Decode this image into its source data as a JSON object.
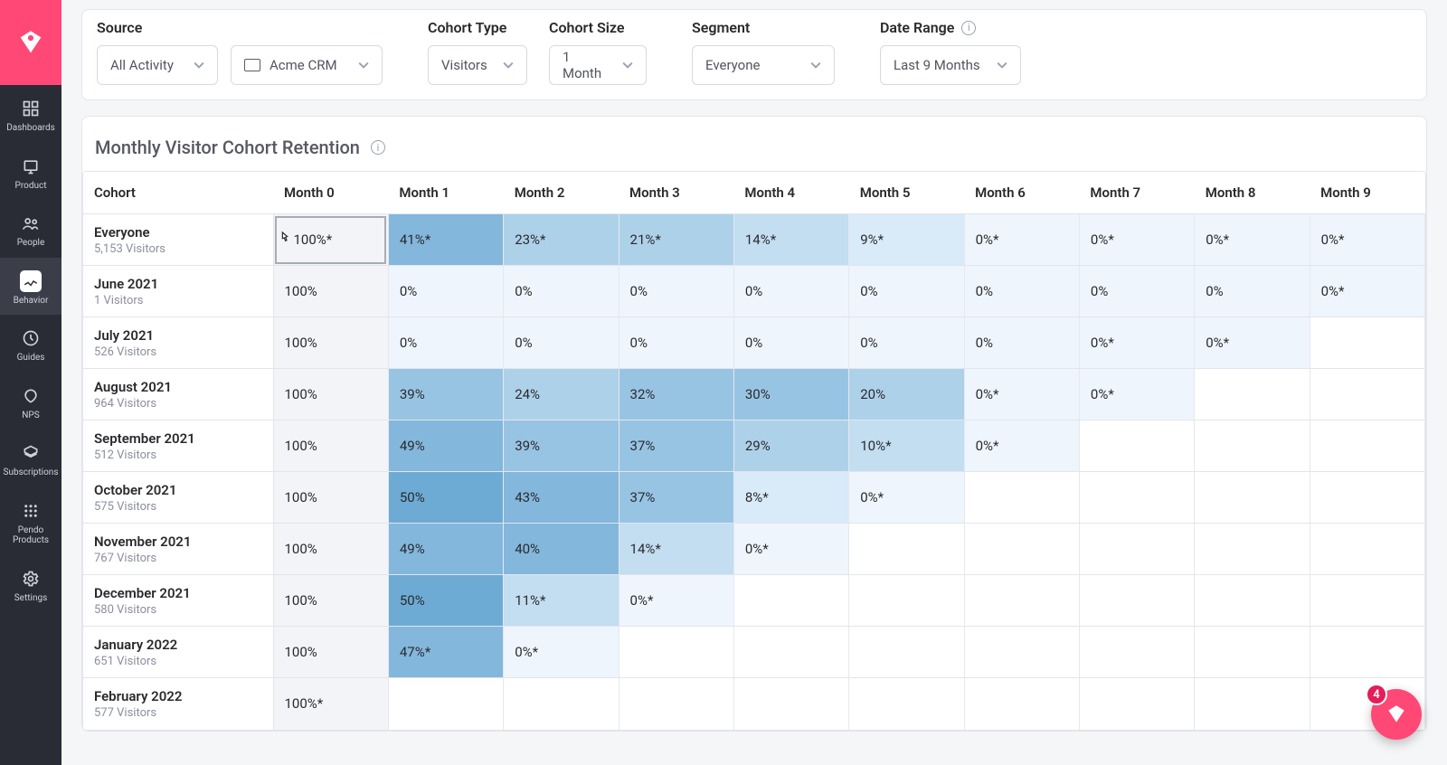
{
  "sidebar": {
    "items": [
      {
        "label": "Dashboards"
      },
      {
        "label": "Product"
      },
      {
        "label": "People"
      },
      {
        "label": "Behavior"
      },
      {
        "label": "Guides"
      },
      {
        "label": "NPS"
      },
      {
        "label": "Subscriptions"
      },
      {
        "label": "Pendo Products"
      },
      {
        "label": "Settings"
      }
    ]
  },
  "filters": {
    "source_label": "Source",
    "activity_value": "All Activity",
    "product_value": "Acme CRM",
    "cohort_type_label": "Cohort Type",
    "cohort_type_value": "Visitors",
    "cohort_size_label": "Cohort Size",
    "cohort_size_value": "1 Month",
    "segment_label": "Segment",
    "segment_value": "Everyone",
    "date_range_label": "Date Range",
    "date_range_value": "Last 9 Months"
  },
  "retention": {
    "title": "Monthly Visitor Cohort Retention",
    "head_cohort": "Cohort",
    "months_prefix": "Month",
    "month_count": 10,
    "heat_palette": {
      "base": "#f3f4f7",
      "levels": [
        "#eef5fc",
        "#d9eaf8",
        "#c3ddf1",
        "#aed1ea",
        "#98c4e3",
        "#83b7dc",
        "#6dabd5"
      ]
    },
    "rows": [
      {
        "name": "Everyone",
        "sub": "5,153 Visitors",
        "vals": [
          "100%*",
          "41%*",
          "23%*",
          "21%*",
          "14%*",
          "9%*",
          "0%*",
          "0%*",
          "0%*",
          "0%*"
        ]
      },
      {
        "name": "June 2021",
        "sub": "1 Visitors",
        "vals": [
          "100%",
          "0%",
          "0%",
          "0%",
          "0%",
          "0%",
          "0%",
          "0%",
          "0%",
          "0%*"
        ]
      },
      {
        "name": "July 2021",
        "sub": "526 Visitors",
        "vals": [
          "100%",
          "0%",
          "0%",
          "0%",
          "0%",
          "0%",
          "0%",
          "0%*",
          "0%*"
        ]
      },
      {
        "name": "August 2021",
        "sub": "964 Visitors",
        "vals": [
          "100%",
          "39%",
          "24%",
          "32%",
          "30%",
          "20%",
          "0%*",
          "0%*"
        ]
      },
      {
        "name": "September 2021",
        "sub": "512 Visitors",
        "vals": [
          "100%",
          "49%",
          "39%",
          "37%",
          "29%",
          "10%*",
          "0%*"
        ]
      },
      {
        "name": "October 2021",
        "sub": "575 Visitors",
        "vals": [
          "100%",
          "50%",
          "43%",
          "37%",
          "8%*",
          "0%*"
        ]
      },
      {
        "name": "November 2021",
        "sub": "767 Visitors",
        "vals": [
          "100%",
          "49%",
          "40%",
          "14%*",
          "0%*"
        ]
      },
      {
        "name": "December 2021",
        "sub": "580 Visitors",
        "vals": [
          "100%",
          "50%",
          "11%*",
          "0%*"
        ]
      },
      {
        "name": "January 2022",
        "sub": "651 Visitors",
        "vals": [
          "100%",
          "47%*",
          "0%*"
        ]
      },
      {
        "name": "February 2022",
        "sub": "577 Visitors",
        "vals": [
          "100%*"
        ]
      }
    ],
    "selected": {
      "row": 0,
      "col": 0
    }
  },
  "float_badge": {
    "count": "4"
  }
}
